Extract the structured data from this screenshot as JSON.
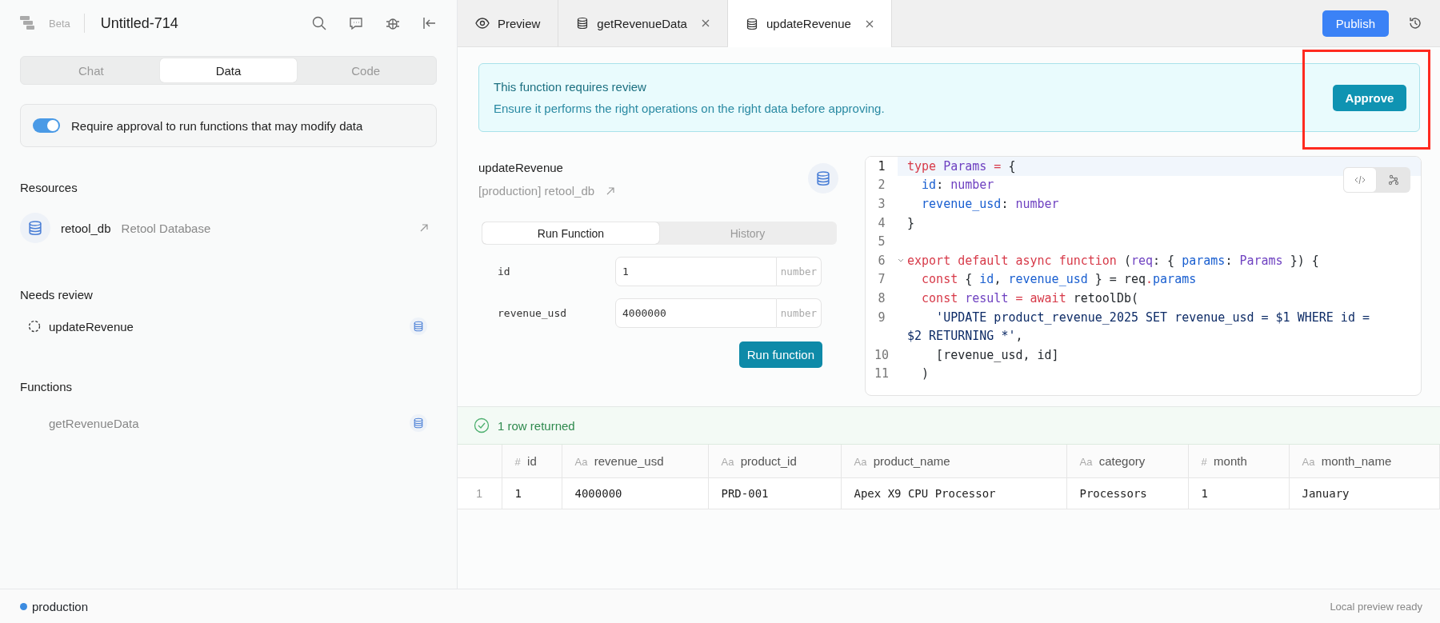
{
  "sidebar": {
    "badge": "Beta",
    "title": "Untitled-714",
    "tabs": [
      {
        "label": "Chat",
        "selected": false
      },
      {
        "label": "Data",
        "selected": true
      },
      {
        "label": "Code",
        "selected": false
      }
    ],
    "approval_toggle": {
      "label": "Require approval to run functions that may modify data",
      "on": true
    },
    "resources": {
      "heading": "Resources",
      "items": [
        {
          "name": "retool_db",
          "type": "Retool Database"
        }
      ]
    },
    "needs_review": {
      "heading": "Needs review",
      "items": [
        {
          "name": "updateRevenue"
        }
      ]
    },
    "functions": {
      "heading": "Functions",
      "items": [
        {
          "name": "getRevenueData"
        }
      ]
    }
  },
  "editor_tabs": [
    {
      "label": "Preview",
      "kind": "preview",
      "selected": false
    },
    {
      "label": "getRevenueData",
      "kind": "function",
      "selected": false
    },
    {
      "label": "updateRevenue",
      "kind": "function",
      "selected": true
    }
  ],
  "publish_button": "Publish",
  "review_banner": {
    "title": "This function requires review",
    "message": "Ensure it performs the right operations on the right data before approving.",
    "button": "Approve"
  },
  "function": {
    "name": "updateRevenue",
    "resource": "[production] retool_db",
    "tabs": [
      {
        "label": "Run Function",
        "selected": true
      },
      {
        "label": "History",
        "selected": false
      }
    ],
    "params": [
      {
        "name": "id",
        "value": "1",
        "type": "number"
      },
      {
        "name": "revenue_usd",
        "value": "4000000",
        "type": "number"
      }
    ],
    "run_button": "Run function"
  },
  "code": {
    "view_modes": [
      {
        "kind": "code",
        "selected": true
      },
      {
        "kind": "graph",
        "selected": false
      }
    ],
    "lines": [
      {
        "number": "1",
        "active": true,
        "foldable": false,
        "tokens": [
          {
            "text": "type",
            "kind": "keyword"
          },
          {
            "text": " Params",
            "kind": "type"
          },
          {
            "text": " = ",
            "kind": "keyword"
          },
          {
            "text": "{",
            "kind": "plain"
          }
        ]
      },
      {
        "number": "2",
        "active": false,
        "foldable": false,
        "tokens": [
          {
            "text": "  id",
            "kind": "property"
          },
          {
            "text": ": ",
            "kind": "plain"
          },
          {
            "text": "number",
            "kind": "type"
          }
        ]
      },
      {
        "number": "3",
        "active": false,
        "foldable": false,
        "tokens": [
          {
            "text": "  revenue_usd",
            "kind": "property"
          },
          {
            "text": ": ",
            "kind": "plain"
          },
          {
            "text": "number",
            "kind": "type"
          }
        ]
      },
      {
        "number": "4",
        "active": false,
        "foldable": false,
        "tokens": [
          {
            "text": "}",
            "kind": "plain"
          }
        ]
      },
      {
        "number": "5",
        "active": false,
        "foldable": false
      },
      {
        "number": "6",
        "active": false,
        "foldable": true,
        "tokens": [
          {
            "text": "export default async function",
            "kind": "keyword"
          },
          {
            "text": " (",
            "kind": "plain"
          },
          {
            "text": "req",
            "kind": "type"
          },
          {
            "text": ": { ",
            "kind": "plain"
          },
          {
            "text": "params",
            "kind": "property"
          },
          {
            "text": ": ",
            "kind": "plain"
          },
          {
            "text": "Params",
            "kind": "type"
          },
          {
            "text": " }) {",
            "kind": "plain"
          }
        ]
      },
      {
        "number": "7",
        "active": false,
        "foldable": false,
        "tokens": [
          {
            "text": "  const",
            "kind": "keyword"
          },
          {
            "text": " { ",
            "kind": "plain"
          },
          {
            "text": "id",
            "kind": "property"
          },
          {
            "text": ", ",
            "kind": "plain"
          },
          {
            "text": "revenue_usd",
            "kind": "property"
          },
          {
            "text": " } = req",
            "kind": "plain"
          },
          {
            "text": ".",
            "kind": "keyword"
          },
          {
            "text": "params",
            "kind": "property"
          }
        ]
      },
      {
        "number": "8",
        "active": false,
        "foldable": false,
        "tokens": [
          {
            "text": "  const",
            "kind": "keyword"
          },
          {
            "text": " result",
            "kind": "type"
          },
          {
            "text": " = ",
            "kind": "keyword"
          },
          {
            "text": "await",
            "kind": "keyword"
          },
          {
            "text": " retoolDb(",
            "kind": "plain"
          }
        ]
      },
      {
        "number": "9",
        "active": false,
        "foldable": false,
        "tokens": [
          {
            "text": "    'UPDATE product_revenue_2025 SET revenue_usd = $1 WHERE id =",
            "kind": "string"
          }
        ],
        "wrap": [
          {
            "text": "$2 RETURNING *'",
            "kind": "string"
          },
          {
            "text": ",",
            "kind": "plain"
          }
        ]
      },
      {
        "number": "10",
        "active": false,
        "foldable": false,
        "tokens": [
          {
            "text": "    [revenue_usd, id]",
            "kind": "plain"
          }
        ]
      },
      {
        "number": "11",
        "active": false,
        "foldable": false,
        "tokens": [
          {
            "text": "  )",
            "kind": "plain"
          }
        ]
      }
    ]
  },
  "result": {
    "status": "1 row returned",
    "columns": [
      {
        "type": "#",
        "label": "id"
      },
      {
        "type": "Aa",
        "label": "revenue_usd"
      },
      {
        "type": "Aa",
        "label": "product_id"
      },
      {
        "type": "Aa",
        "label": "product_name"
      },
      {
        "type": "Aa",
        "label": "category"
      },
      {
        "type": "#",
        "label": "month"
      },
      {
        "type": "Aa",
        "label": "month_name"
      }
    ],
    "rows": [
      {
        "number": "1",
        "cells": [
          "1",
          "4000000",
          "PRD-001",
          "Apex X9 CPU Processor",
          "Processors",
          "1",
          "January"
        ]
      }
    ]
  },
  "status_bar": {
    "environment": "production",
    "message": "Local preview ready"
  }
}
